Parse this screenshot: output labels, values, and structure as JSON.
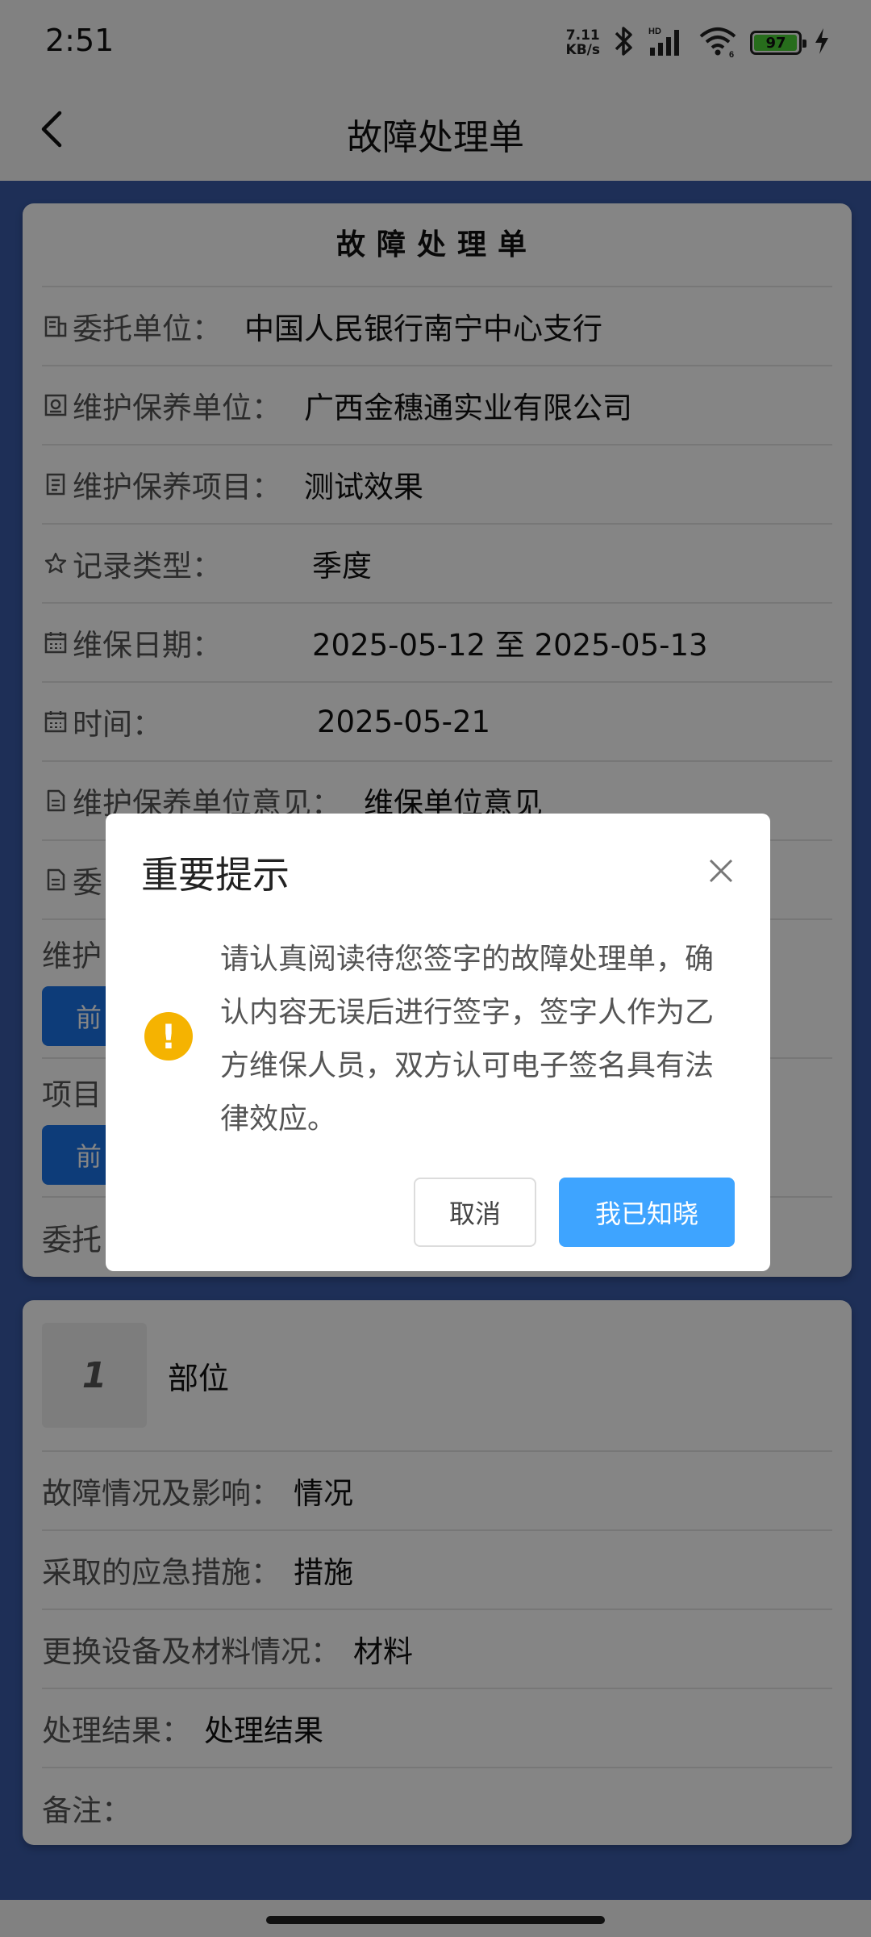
{
  "status_bar": {
    "time": "2:51",
    "net_speed_value": "7.11",
    "net_speed_unit": "KB/s",
    "battery_level": "97",
    "icons": [
      "bluetooth-icon",
      "signal-icon",
      "wifi-icon",
      "battery-icon",
      "charging-icon"
    ]
  },
  "nav": {
    "title": "故障处理单",
    "back_icon": "chevron-left-icon"
  },
  "card1": {
    "title": "故障处理单",
    "rows": [
      {
        "icon": "building-icon",
        "label": "委托单位：",
        "value": "中国人民银行南宁中心支行"
      },
      {
        "icon": "maintain-unit-icon",
        "label": "维护保养单位：",
        "value": "广西金穗通实业有限公司"
      },
      {
        "icon": "list-icon",
        "label": "维护保养项目：",
        "value": "测试效果"
      },
      {
        "icon": "star-icon",
        "label": "记录类型：",
        "value": "季度"
      },
      {
        "icon": "calendar-icon",
        "label": "维保日期：",
        "value": "2025-05-12 至 2025-05-13"
      },
      {
        "icon": "calendar-icon",
        "label": "时间：",
        "value": "2025-05-21"
      },
      {
        "icon": "document-icon",
        "label": "维护保养单位意见：",
        "value": "维保单位意见"
      },
      {
        "icon": "document-icon",
        "label": "委",
        "value": ""
      }
    ],
    "sign_rows": [
      {
        "label": "维护",
        "button": "前"
      },
      {
        "label": "项目",
        "button": "前"
      }
    ],
    "last_row_label": "委托"
  },
  "card2": {
    "part_number": "1",
    "part_name": "部位",
    "rows": [
      {
        "label": "故障情况及影响：",
        "value": "情况"
      },
      {
        "label": "采取的应急措施：",
        "value": "措施"
      },
      {
        "label": "更换设备及材料情况：",
        "value": "材料"
      },
      {
        "label": "处理结果：",
        "value": "处理结果"
      },
      {
        "label": "备注：",
        "value": ""
      }
    ]
  },
  "dialog": {
    "title": "重要提示",
    "message": "请认真阅读待您签字的故障处理单，确认内容无误后进行签字，签字人作为乙方维保人员，双方认可电子签名具有法律效应。",
    "cancel_label": "取消",
    "confirm_label": "我已知晓",
    "warn_glyph": "!",
    "close_icon": "close-icon"
  },
  "colors": {
    "page_background": "#3a5ba8",
    "primary_button": "#3ea4ff",
    "sign_button": "#1a73e8",
    "warning": "#f5b301"
  }
}
